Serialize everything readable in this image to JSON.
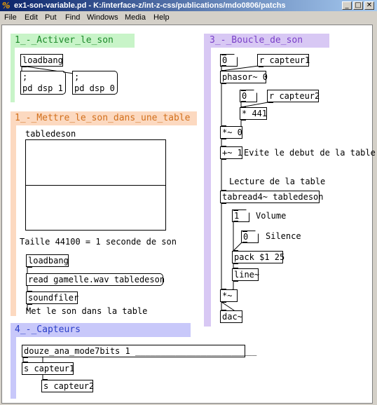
{
  "window": {
    "title": "ex1-son-variable.pd - K:/interface-z/int-z-css/publications/mdo0806/patchs",
    "icon": "pd-logo-icon",
    "buttons": {
      "minimize": "_",
      "maximize": "□",
      "close": "✕"
    }
  },
  "menu": [
    "File",
    "Edit",
    "Put",
    "Find",
    "Windows",
    "Media",
    "Help"
  ],
  "sections": {
    "s1": {
      "title": "1_-_Activer_le_son",
      "color": "#c8f4c8"
    },
    "s2": {
      "title": "1_-_Mettre_le_son_dans_une_table",
      "color": "#fcd9c0"
    },
    "s3": {
      "title": "3_-_Boucle_de_son",
      "color": "#d8c8f4"
    },
    "s4": {
      "title": "4_-_Capteurs",
      "color": "#c8c8fa"
    }
  },
  "s1": {
    "loadbang": "loadbang",
    "msg_dsp1": ";\npd dsp 1",
    "msg_dsp0": ";\npd dsp 0"
  },
  "s2": {
    "array_name": "tabledeson",
    "comment_size": "Taille 44100 = 1 seconde de son",
    "loadbang": "loadbang",
    "read_msg": "read gamelle.wav tabledeson",
    "soundfiler": "soundfiler",
    "comment_load": "Met le son dans la table"
  },
  "s3": {
    "num_speed": "0",
    "recv1": "r capteur1",
    "phasor": "phasor~ 0",
    "num_scale": "0",
    "recv2": "r capteur2",
    "mul441": "* 441",
    "mulsig": "*~ 0",
    "addsig": "+~ 1",
    "comment_skip": "Evite le debut de la table",
    "comment_read": "Lecture de la table",
    "tabread": "tabread4~ tabledeson",
    "num_volume": "1",
    "comment_volume": "Volume",
    "num_silence": "0",
    "comment_silence": "Silence",
    "pack": "pack $1 25",
    "line": "line~",
    "mulout": "*~",
    "dac": "dac~"
  },
  "s4": {
    "sensor_obj": "douze_ana_mode7bits 1 ________________________",
    "send1": "s capteur1",
    "send2": "s capteur2"
  }
}
